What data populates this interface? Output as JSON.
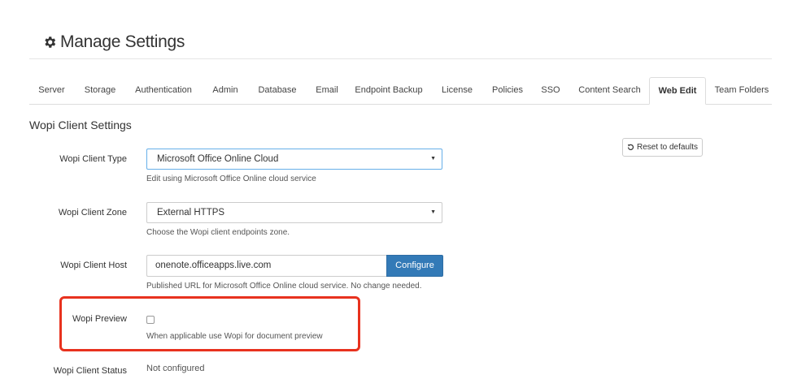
{
  "page": {
    "title": "Manage Settings",
    "icon": "gear-icon"
  },
  "tabs": [
    {
      "label": "Server"
    },
    {
      "label": "Storage"
    },
    {
      "label": "Authentication"
    },
    {
      "label": "Admin"
    },
    {
      "label": "Database"
    },
    {
      "label": "Email"
    },
    {
      "label": "Endpoint Backup"
    },
    {
      "label": "License"
    },
    {
      "label": "Policies"
    },
    {
      "label": "SSO"
    },
    {
      "label": "Content Search"
    },
    {
      "label": "Web Edit",
      "active": true
    },
    {
      "label": "Team Folders"
    }
  ],
  "section": {
    "title": "Wopi Client Settings"
  },
  "reset_button": {
    "label": "Reset to defaults",
    "icon": "undo-icon"
  },
  "fields": {
    "client_type": {
      "label": "Wopi Client Type",
      "value": "Microsoft Office Online Cloud",
      "help": "Edit using Microsoft Office Online cloud service"
    },
    "client_zone": {
      "label": "Wopi Client Zone",
      "value": "External HTTPS",
      "help": "Choose the Wopi client endpoints zone."
    },
    "client_host": {
      "label": "Wopi Client Host",
      "value": "onenote.officeapps.live.com",
      "button": "Configure",
      "help": "Published URL for Microsoft Office Online cloud service. No change needed."
    },
    "preview": {
      "label": "Wopi Preview",
      "checked": false,
      "help": "When applicable use Wopi for document preview"
    },
    "status": {
      "label": "Wopi Client Status",
      "value": "Not configured"
    }
  },
  "colors": {
    "accent": "#337ab7",
    "highlight": "#e8321e"
  }
}
